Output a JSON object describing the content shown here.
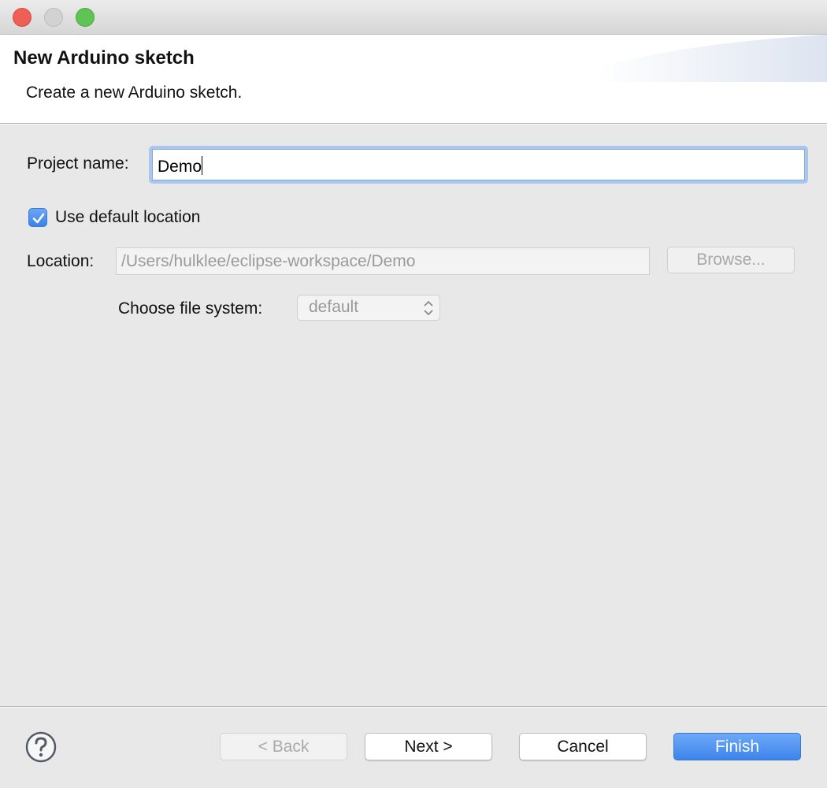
{
  "window": {
    "controls": [
      "close",
      "minimize",
      "zoom"
    ]
  },
  "header": {
    "title": "New Arduino sketch",
    "description": "Create a new Arduino sketch."
  },
  "form": {
    "project_name_label": "Project name:",
    "project_name_value": "Demo",
    "use_default_location_label": "Use default location",
    "use_default_location_checked": true,
    "location_label": "Location:",
    "location_value": "/Users/hulklee/eclipse-workspace/Demo",
    "browse_label": "Browse...",
    "file_system_label": "Choose file system:",
    "file_system_value": "default"
  },
  "footer": {
    "help_icon": "question-mark-circle",
    "back_label": "< Back",
    "next_label": "Next >",
    "cancel_label": "Cancel",
    "finish_label": "Finish"
  },
  "colors": {
    "accent": "#3c83ec",
    "focus_ring": "#a9c6ee"
  }
}
